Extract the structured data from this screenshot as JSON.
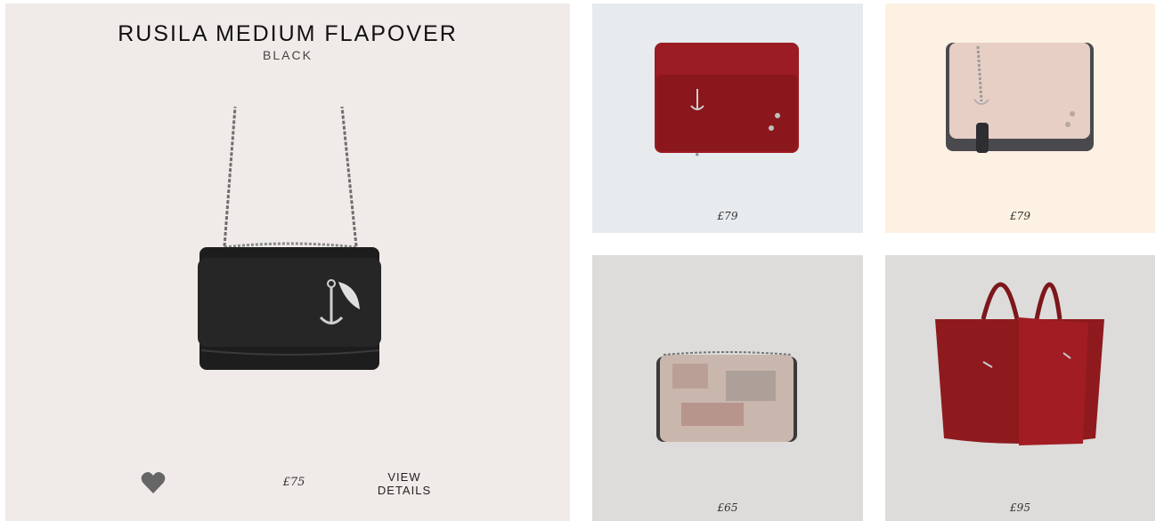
{
  "featured": {
    "title": "RUSILA MEDIUM FLAPOVER",
    "color": "BLACK",
    "price": "£75",
    "view_details": "VIEW DETAILS",
    "bg": "#f0ebe8",
    "favorite_icon": "heart-icon"
  },
  "grid": [
    {
      "price": "£79",
      "bag_color": "#9b1c22",
      "bg": "#e7ebee"
    },
    {
      "price": "£79",
      "bag_color": "#e7cfc6",
      "bg": "#fdf1e3"
    },
    {
      "price": "£65",
      "bag_color": "#c9b6ad",
      "bg": "#dddcda"
    },
    {
      "price": "£95",
      "bag_color": "#8e1a1e",
      "bg": "#dddcda"
    }
  ]
}
